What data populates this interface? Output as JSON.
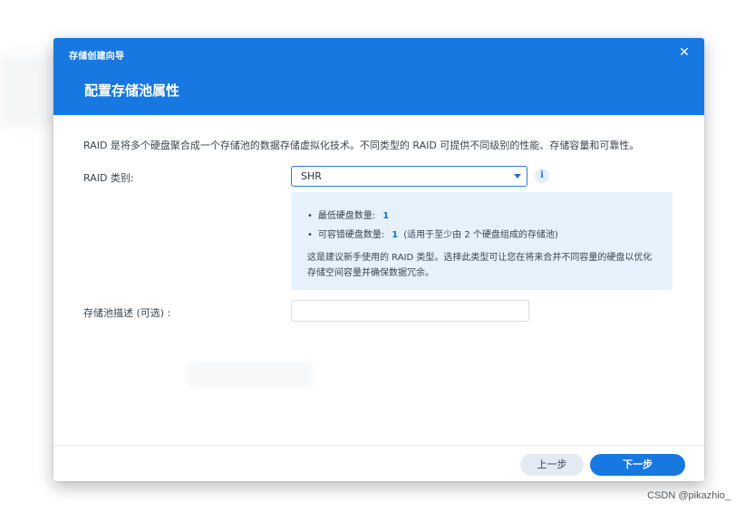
{
  "wizard": {
    "title": "存储创建向导",
    "page_title": "配置存储池属性",
    "close_icon": "close-icon"
  },
  "description": "RAID 是将多个硬盘聚合成一个存储池的数据存储虚拟化技术。不同类型的 RAID 可提供不同级别的性能、存储容量和可靠性。",
  "raid": {
    "label": "RAID 类别:",
    "selected": "SHR",
    "info_icon": "info-icon"
  },
  "info": {
    "min_label": "最低硬盘数量:",
    "min_value": "1",
    "tolerance_label": "可容错硬盘数量:",
    "tolerance_value": "1",
    "tolerance_note": "(适用于至少由 2 个硬盘组成的存储池)",
    "paragraph": "这是建议新手使用的 RAID 类型。选择此类型可让您在将来合并不同容量的硬盘以优化存储空间容量并确保数据冗余。"
  },
  "pool_desc": {
    "label": "存储池描述 (可选) :",
    "value": "",
    "placeholder": ""
  },
  "buttons": {
    "prev": "上一步",
    "next": "下一步"
  },
  "watermark": "CSDN @pikazhio_",
  "colors": {
    "accent": "#1678e0",
    "info_bg": "#e6f1fc",
    "text": "#3a4552"
  }
}
